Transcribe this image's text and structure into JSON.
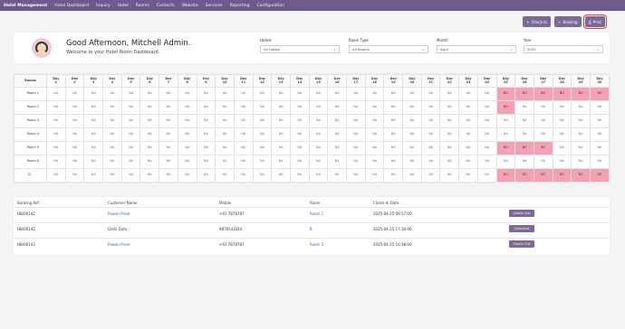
{
  "topbar": {
    "brand": "Hotel Management",
    "menu": [
      "Hotel Dashboard",
      "Inquiry",
      "Hotel",
      "Rooms",
      "Contacts",
      "Website",
      "Services",
      "Reporting",
      "Configuration"
    ]
  },
  "actions": {
    "checkin": "Check-In",
    "booking": "Booking",
    "print": "Print"
  },
  "header": {
    "greeting": "Good Afternoon, Mitchell Admin.",
    "welcome": "Welcome to your Hotel Room Dashboard.",
    "filters": [
      {
        "label": "Hotels",
        "value": "All Hotels"
      },
      {
        "label": "Room Type",
        "value": "All Rooms"
      },
      {
        "label": "Month",
        "value": "April"
      },
      {
        "label": "Year",
        "value": "2025"
      }
    ]
  },
  "grid": {
    "room_header": "Rooms",
    "day_prefix": "Day",
    "days": 30,
    "rooms": [
      {
        "name": "Room 1",
        "cells": [
          "NA",
          "NA",
          "NA",
          "NA",
          "NA",
          "NA",
          "NA",
          "NA",
          "NA",
          "NA",
          "NA",
          "NA",
          "NA",
          "NA",
          "NA",
          "NA",
          "NA",
          "NA",
          "NA",
          "NA",
          "NA",
          "NA",
          "NA",
          "NA",
          "BO",
          "BO",
          "BO",
          "BO",
          "BO",
          "BO"
        ]
      },
      {
        "name": "Room 2",
        "cells": [
          "NA",
          "NA",
          "NA",
          "NA",
          "NA",
          "NA",
          "NA",
          "NA",
          "NA",
          "NA",
          "NA",
          "NA",
          "NA",
          "NA",
          "NA",
          "NA",
          "NA",
          "NA",
          "NA",
          "NA",
          "NA",
          "NA",
          "NA",
          "NA",
          "BO",
          "NA",
          "NA",
          "NA",
          "NA",
          "NA"
        ]
      },
      {
        "name": "Room 3",
        "cells": [
          "NA",
          "NA",
          "NA",
          "NA",
          "NA",
          "NA",
          "NA",
          "NA",
          "NA",
          "NA",
          "NA",
          "NA",
          "NA",
          "NA",
          "NA",
          "NA",
          "NA",
          "NA",
          "NA",
          "NA",
          "NA",
          "NA",
          "NA",
          "NA",
          "NA",
          "NA",
          "NA",
          "NA",
          "NA",
          "NA"
        ]
      },
      {
        "name": "Room 4",
        "cells": [
          "NA",
          "NA",
          "NA",
          "NA",
          "NA",
          "NA",
          "NA",
          "NA",
          "NA",
          "NA",
          "NA",
          "NA",
          "NA",
          "NA",
          "NA",
          "NA",
          "NA",
          "NA",
          "NA",
          "NA",
          "NA",
          "NA",
          "NA",
          "NA",
          "NA",
          "NA",
          "NA",
          "NA",
          "NA",
          "NA"
        ]
      },
      {
        "name": "Room 5",
        "cells": [
          "NA",
          "NA",
          "NA",
          "NA",
          "NA",
          "NA",
          "NA",
          "NA",
          "NA",
          "NA",
          "NA",
          "NA",
          "NA",
          "NA",
          "NA",
          "NA",
          "NA",
          "NA",
          "NA",
          "NA",
          "NA",
          "NA",
          "NA",
          "NA",
          "BO",
          "BO",
          "BO",
          "NA",
          "NA",
          "NA"
        ]
      },
      {
        "name": "Room 6",
        "cells": [
          "NA",
          "NA",
          "NA",
          "NA",
          "NA",
          "NA",
          "NA",
          "NA",
          "NA",
          "NA",
          "NA",
          "NA",
          "NA",
          "NA",
          "NA",
          "NA",
          "NA",
          "NA",
          "NA",
          "NA",
          "NA",
          "NA",
          "NA",
          "NA",
          "NA",
          "NA",
          "NA",
          "NA",
          "NA",
          "NA"
        ]
      },
      {
        "name": "12",
        "cells": [
          "NA",
          "NA",
          "NA",
          "NA",
          "NA",
          "NA",
          "NA",
          "NA",
          "NA",
          "NA",
          "NA",
          "NA",
          "NA",
          "NA",
          "NA",
          "NA",
          "NA",
          "NA",
          "NA",
          "NA",
          "NA",
          "NA",
          "NA",
          "NA",
          "BO",
          "BO",
          "BO",
          "BO",
          "BO",
          "BO"
        ]
      }
    ]
  },
  "bookings": {
    "headers": [
      "Booking Ref",
      "Customer Name",
      "Mobile",
      "Room",
      "Check-In Date"
    ],
    "rows": [
      {
        "ref": "HB/00142",
        "customer": "Pawan Preet",
        "mobile": "+91 7878787",
        "room": "Room 1",
        "date": "2025-04-25 09:57:00",
        "action": "Check-Out"
      },
      {
        "ref": "HB/00145",
        "customer": "Delhi Data",
        "mobile": "9876543210",
        "room": "6",
        "date": "2025-04-25 17:30:00",
        "action": "Checkout"
      },
      {
        "ref": "HB/00143",
        "customer": "Pawan Preet",
        "mobile": "+91 7878787",
        "room": "Room 5",
        "date": "2025-04-25 10:38:00",
        "action": "Check-Out"
      }
    ]
  },
  "colors": {
    "brand": "#6e5a8c",
    "button": "#7b6a98",
    "booked": "#f4a1b6",
    "available_text": "#5b73b5"
  }
}
